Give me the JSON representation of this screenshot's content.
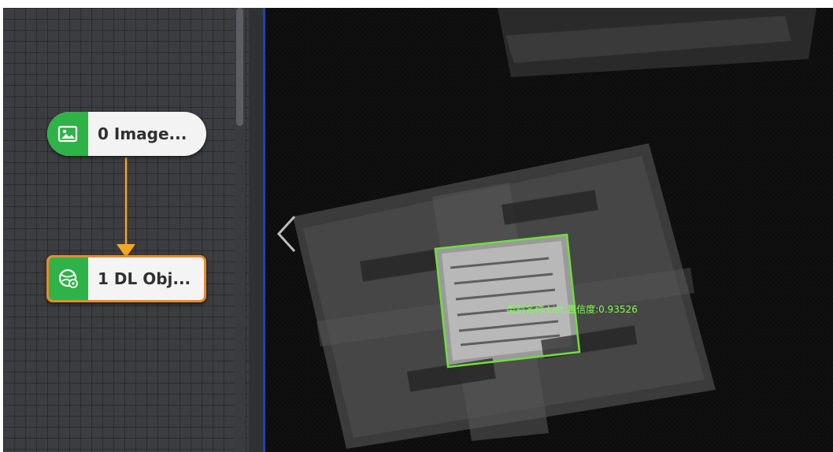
{
  "flow": {
    "nodes": [
      {
        "index": "0",
        "label": "0 Image...",
        "icon": "image-icon",
        "color": "#2fb247"
      },
      {
        "index": "1",
        "label": "1 DL Obj...",
        "icon": "dl-object-icon",
        "color": "#2fb247",
        "selected": true
      }
    ],
    "connector_color": "#f5a623",
    "selected_border_color": "#e98a2b"
  },
  "viewer": {
    "detection": {
      "label": "类别名称:List;置信度:0.93526",
      "box_color": "#6ee03a"
    },
    "navigation": {
      "prev_icon": "chevron-left-icon"
    }
  }
}
